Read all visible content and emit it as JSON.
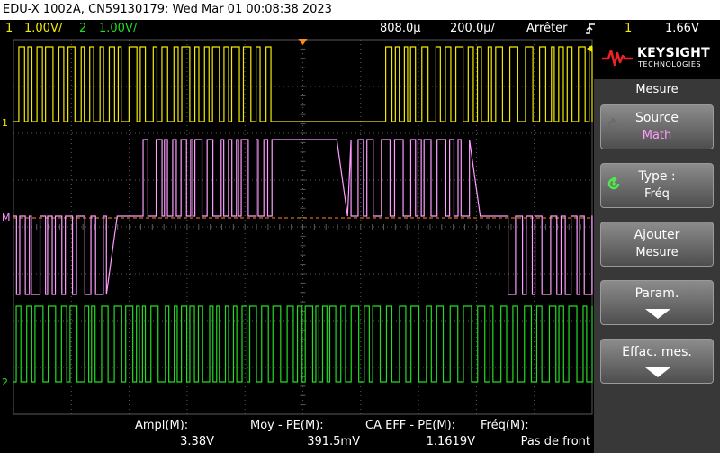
{
  "title": "EDU-X 1002A, CN59130179: Wed Mar 01 00:08:38 2023",
  "status": {
    "ch1_num": "1",
    "ch1_scale": "1.00V/",
    "ch2_num": "2",
    "ch2_scale": "1.00V/",
    "timebase": "808.0µ",
    "timescale": "200.0µ/",
    "run_state": "Arrêter",
    "trigger_icon": "rising-edge-icon",
    "trigger_source": "1",
    "trigger_level": "1.66V"
  },
  "markers": {
    "ch1": "1",
    "ch2": "2",
    "math": "M"
  },
  "panel": {
    "brand": "KEYSIGHT",
    "brand_sub": "TECHNOLOGIES",
    "title": "Mesure",
    "buttons": [
      {
        "line1": "Source",
        "line2": "Math"
      },
      {
        "line1": "Type :",
        "line2": "Fréq"
      },
      {
        "line1": "Ajouter",
        "line2": "Mesure"
      },
      {
        "line1": "Param."
      },
      {
        "line1": "Effac. mes."
      }
    ]
  },
  "measurements": [
    {
      "label": "Ampl(M):",
      "value": "3.38V"
    },
    {
      "label": "Moy - PE(M):",
      "value": "391.5mV"
    },
    {
      "label": "CA EFF - PE(M):",
      "value": "1.1619V"
    },
    {
      "label": "Fréq(M):",
      "value": "Pas de front"
    }
  ],
  "colors": {
    "ch1": "#f4ea00",
    "ch2": "#22dd22",
    "math": "#ff9cff",
    "trigger": "#ff8c1a",
    "grid": "#5a5a5a"
  }
}
